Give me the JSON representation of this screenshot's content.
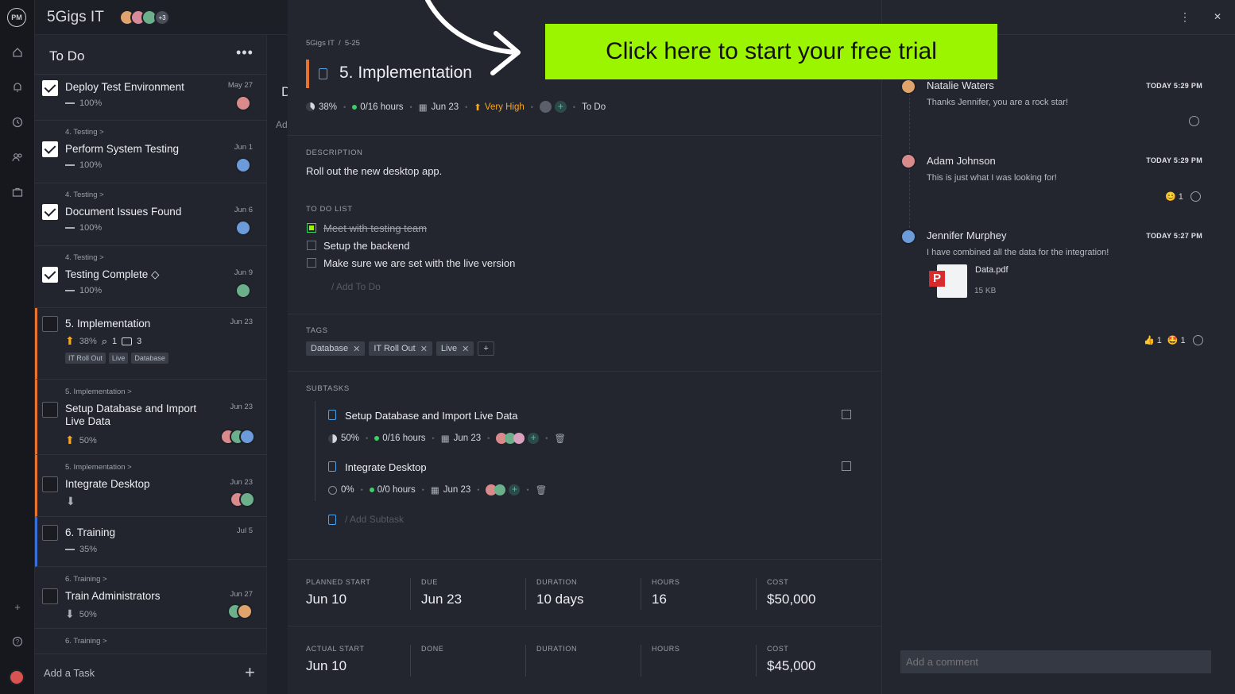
{
  "app": {
    "project_title": "5Gigs IT",
    "member_count_badge": "+3"
  },
  "rail": {
    "logo": "PM"
  },
  "column": {
    "title": "To Do",
    "more": "•••",
    "add_task": "Add a Task",
    "add_icon": "+",
    "next_col_initial": "D",
    "next_col_add": "Ad"
  },
  "cards": [
    {
      "title": "Deploy Test Environment",
      "date": "May 27",
      "progress": "100%",
      "done": true
    },
    {
      "crumb": "4. Testing >",
      "title": "Perform System Testing",
      "date": "Jun 1",
      "progress": "100%",
      "done": true
    },
    {
      "crumb": "4. Testing >",
      "title": "Document Issues Found",
      "date": "Jun 6",
      "progress": "100%",
      "done": true
    },
    {
      "crumb": "4. Testing >",
      "title": "Testing Complete ◇",
      "date": "Jun 9",
      "progress": "100%",
      "done": true
    },
    {
      "title": "5. Implementation",
      "date": "Jun 23",
      "progress": "38%",
      "attachments": "1",
      "comments": "3",
      "tags": [
        "IT Roll Out",
        "Live",
        "Database"
      ],
      "done": false
    },
    {
      "crumb": "5. Implementation >",
      "title": "Setup Database and Import Live Data",
      "date": "Jun 23",
      "progress": "50%",
      "done": false
    },
    {
      "crumb": "5. Implementation >",
      "title": "Integrate Desktop",
      "date": "Jun 23",
      "done": false
    },
    {
      "title": "6. Training",
      "date": "Jul 5",
      "progress": "35%",
      "done": false
    },
    {
      "crumb": "6. Training >",
      "title": "Train Administrators",
      "date": "Jun 27",
      "progress": "50%",
      "done": false
    },
    {
      "crumb": "6. Training >"
    }
  ],
  "detail": {
    "breadcrumb": "5Gigs IT  /  5-25",
    "title": "5. Implementation",
    "progress": "38%",
    "hours": "0/16 hours",
    "due": "Jun 23",
    "priority": "Very High",
    "status": "To Do",
    "description_label": "DESCRIPTION",
    "description": "Roll out the new desktop app.",
    "todo_label": "TO DO LIST",
    "todos": [
      "Meet with testing team",
      "Setup the backend",
      "Make sure we are set with the live version"
    ],
    "add_todo": "/ Add To Do",
    "tags_label": "TAGS",
    "tags": [
      "Database",
      "IT Roll Out",
      "Live"
    ],
    "add_tag": "+",
    "subtasks_label": "SUBTASKS",
    "subtasks": [
      {
        "title": "Setup Database and Import Live Data",
        "progress": "50%",
        "hours": "0/16 hours",
        "due": "Jun 23"
      },
      {
        "title": "Integrate Desktop",
        "progress": "0%",
        "hours": "0/0 hours",
        "due": "Jun 23"
      }
    ],
    "add_subtask": "/ Add Subtask",
    "planned": [
      {
        "label": "PLANNED START",
        "value": "Jun 10"
      },
      {
        "label": "DUE",
        "value": "Jun 23"
      },
      {
        "label": "DURATION",
        "value": "10 days"
      },
      {
        "label": "HOURS",
        "value": "16"
      },
      {
        "label": "COST",
        "value": "$50,000"
      }
    ],
    "actual": [
      {
        "label": "ACTUAL START",
        "value": "Jun 10"
      },
      {
        "label": "DONE",
        "value": ""
      },
      {
        "label": "DURATION",
        "value": ""
      },
      {
        "label": "HOURS",
        "value": ""
      },
      {
        "label": "COST",
        "value": "$45,000"
      }
    ]
  },
  "comments": [
    {
      "name": "Natalie Waters",
      "time": "TODAY 5:29 PM",
      "text": "Thanks Jennifer, you are a rock star!"
    },
    {
      "name": "Adam Johnson",
      "time": "TODAY 5:29 PM",
      "text": "This is just what I was looking for!",
      "reaction": "😊",
      "reaction_count": "1"
    },
    {
      "name": "Jennifer Murphey",
      "time": "TODAY 5:27 PM",
      "text": "I have combined all the data for the integration!",
      "file_name": "Data.pdf",
      "file_size": "15 KB",
      "reactions": [
        {
          "emoji": "👍",
          "count": "1"
        },
        {
          "emoji": "🤩",
          "count": "1"
        }
      ]
    }
  ],
  "comment_placeholder": "Add a comment",
  "window": {
    "more": "⋮",
    "close": "✕"
  },
  "cta": "Click here to start your free trial",
  "colors": {
    "accent_green": "#9cf500",
    "orange": "#e8732c",
    "priority": "#f5a623",
    "done_green": "#3ccf63"
  }
}
